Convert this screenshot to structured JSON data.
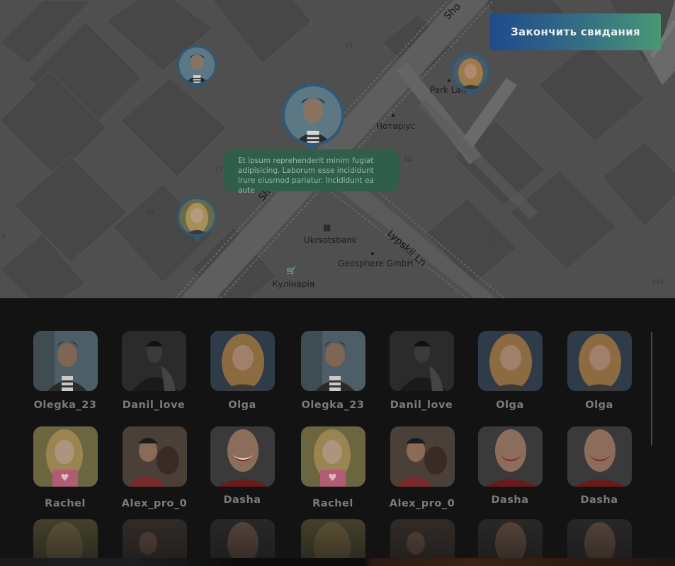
{
  "header": {
    "end_button_label": "Закончить свидания"
  },
  "map": {
    "streets": [
      "Shovko",
      "Sho",
      "Lypskii Ln"
    ],
    "places": [
      "Park Lan",
      "Нотаріус",
      "Ukrsotsbank",
      "Geosphere GmbH",
      "Кулінарія"
    ],
    "house_numbers": [
      "11",
      "17",
      "14",
      "7",
      "12",
      "9",
      "123"
    ],
    "icons": [
      "bank-icon",
      "cart-icon"
    ],
    "message_bubble": "Et ipsum reprehenderit minim fugiat adipisicing. Laborum esse incididunt irure eiusmod pariatur. Incididunt ea aute",
    "pin_color": "#2d5a78"
  },
  "users": {
    "row1": [
      "Olegka_23",
      "Danil_love",
      "Olga",
      "Olegka_23",
      "Danil_love",
      "Olga",
      "Olga"
    ],
    "row2": [
      "Rachel",
      "Alex_pro_0",
      "Dasha",
      "Rachel",
      "Alex_pro_0",
      "Dasha",
      "Dasha"
    ]
  },
  "colors": {
    "button_gradient_start": "#1f4a8c",
    "button_gradient_end": "#4a9776",
    "bubble": "#2f5e4b",
    "heart_badge": "#b05c73"
  }
}
